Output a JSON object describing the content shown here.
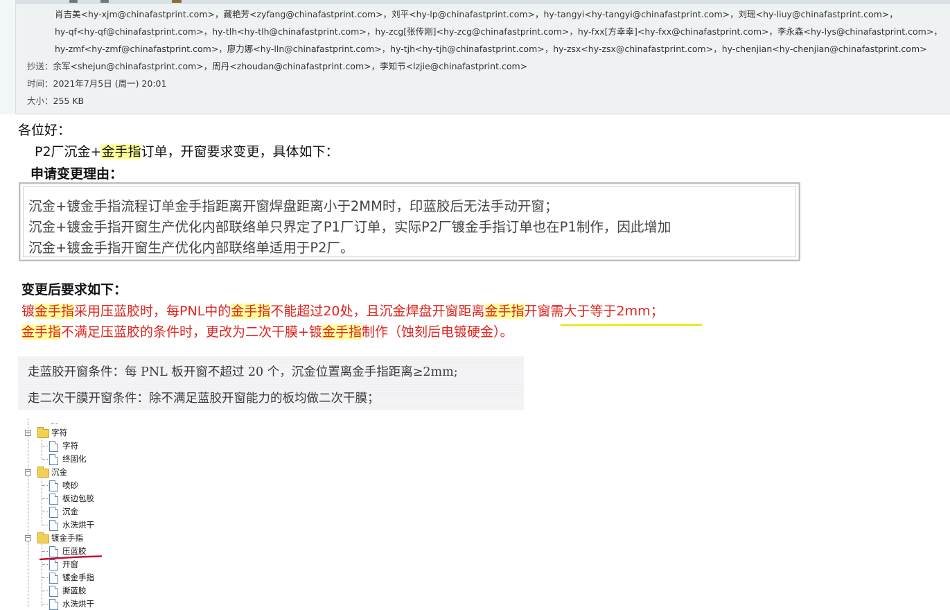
{
  "header": {
    "to_lines": [
      "肖吉美<hy-xjm@chinafastprint.com>，藏艳芳<zyfang@chinafastprint.com>，刘平<hy-lp@chinafastprint.com>，hy-tangyi<hy-tangyi@chinafastprint.com>，刘瑶<hy-liuy@chinafastprint.com>，",
      "hy-qf<hy-qf@chinafastprint.com>，hy-tlh<hy-tlh@chinafastprint.com>，hy-zcg[张传刚]<hy-zcg@chinafastprint.com>，hy-fxx[方幸幸]<hy-fxx@chinafastprint.com>，李永森<hy-lys@chinafastprint.com>，",
      "hy-zmf<hy-zmf@chinafastprint.com>，廖力娜<hy-lln@chinafastprint.com>，hy-tjh<hy-tjh@chinafastprint.com>，hy-zsx<hy-zsx@chinafastprint.com>，hy-chenjian<hy-chenjian@chinafastprint.com>"
    ],
    "cc_label": "抄送：",
    "cc_value": "余军<shejun@chinafastprint.com>，周丹<zhoudan@chinafastprint.com>，李知节<lzjie@chinafastprint.com>",
    "time_label": "时间：",
    "time_value": "2021年7月5日 (周一) 20:01",
    "size_label": "大小：",
    "size_value": "255 KB"
  },
  "body": {
    "greeting": "各位好：",
    "intro_pre": "P2厂沉金+",
    "intro_hl": "金手指",
    "intro_post": "订单，开窗要求变更，具体如下：",
    "reason_title": "申请变更理由：",
    "reason_lines": [
      "沉金+镀金手指流程订单金手指距离开窗焊盘距离小于2MM时，印蓝胶后无法手动开窗；",
      "沉金+镀金手指开窗生产优化内部联络单只界定了P1厂订单，实际P2厂镀金手指订单也在P1制作，因此增加",
      "沉金+镀金手指开窗生产优化内部联络单适用于P2厂。"
    ],
    "req_title": "变更后要求如下：",
    "req1": [
      "镀",
      "金手指",
      "采用压蓝胶时，每PNL中的",
      "金手指",
      "不能超过20处，且沉金焊盘开窗距离",
      "金手指",
      "开窗需大于等于2mm；"
    ],
    "req2": [
      "金手指",
      "不满足压蓝胶的条件时，更改为二次干膜+镀",
      "金手指",
      "制作（蚀刻后电镀硬金）。"
    ]
  },
  "scan": {
    "line1": "走蓝胶开窗条件：每 PNL 板开窗不超过 20 个，沉金位置离金手指距离≥2mm;",
    "line2": "走二次干膜开窗条件：除不满足蓝胶开窗能力的板均做二次干膜；"
  },
  "tree": {
    "folders": [
      {
        "label": "字符",
        "children": [
          "字符",
          "终固化"
        ]
      },
      {
        "label": "沉金",
        "children": [
          "喷砂",
          "板边包胶",
          "沉金",
          "水洗烘干"
        ]
      },
      {
        "label": "镀金手指",
        "children": [
          "压蓝胶",
          "开窗",
          "镀金手指",
          "撕蓝胶",
          "水洗烘干"
        ]
      }
    ],
    "collapse_symbol": "−"
  },
  "colors": {
    "highlight": "#ffff99",
    "requirement_red": "#e0241c",
    "header_bg": "#eef2f2",
    "annotation_yellow": "#e8e820",
    "annotation_red": "#c8102e"
  },
  "icons": [
    "folder-icon",
    "document-icon",
    "collapse-minus-icon"
  ]
}
